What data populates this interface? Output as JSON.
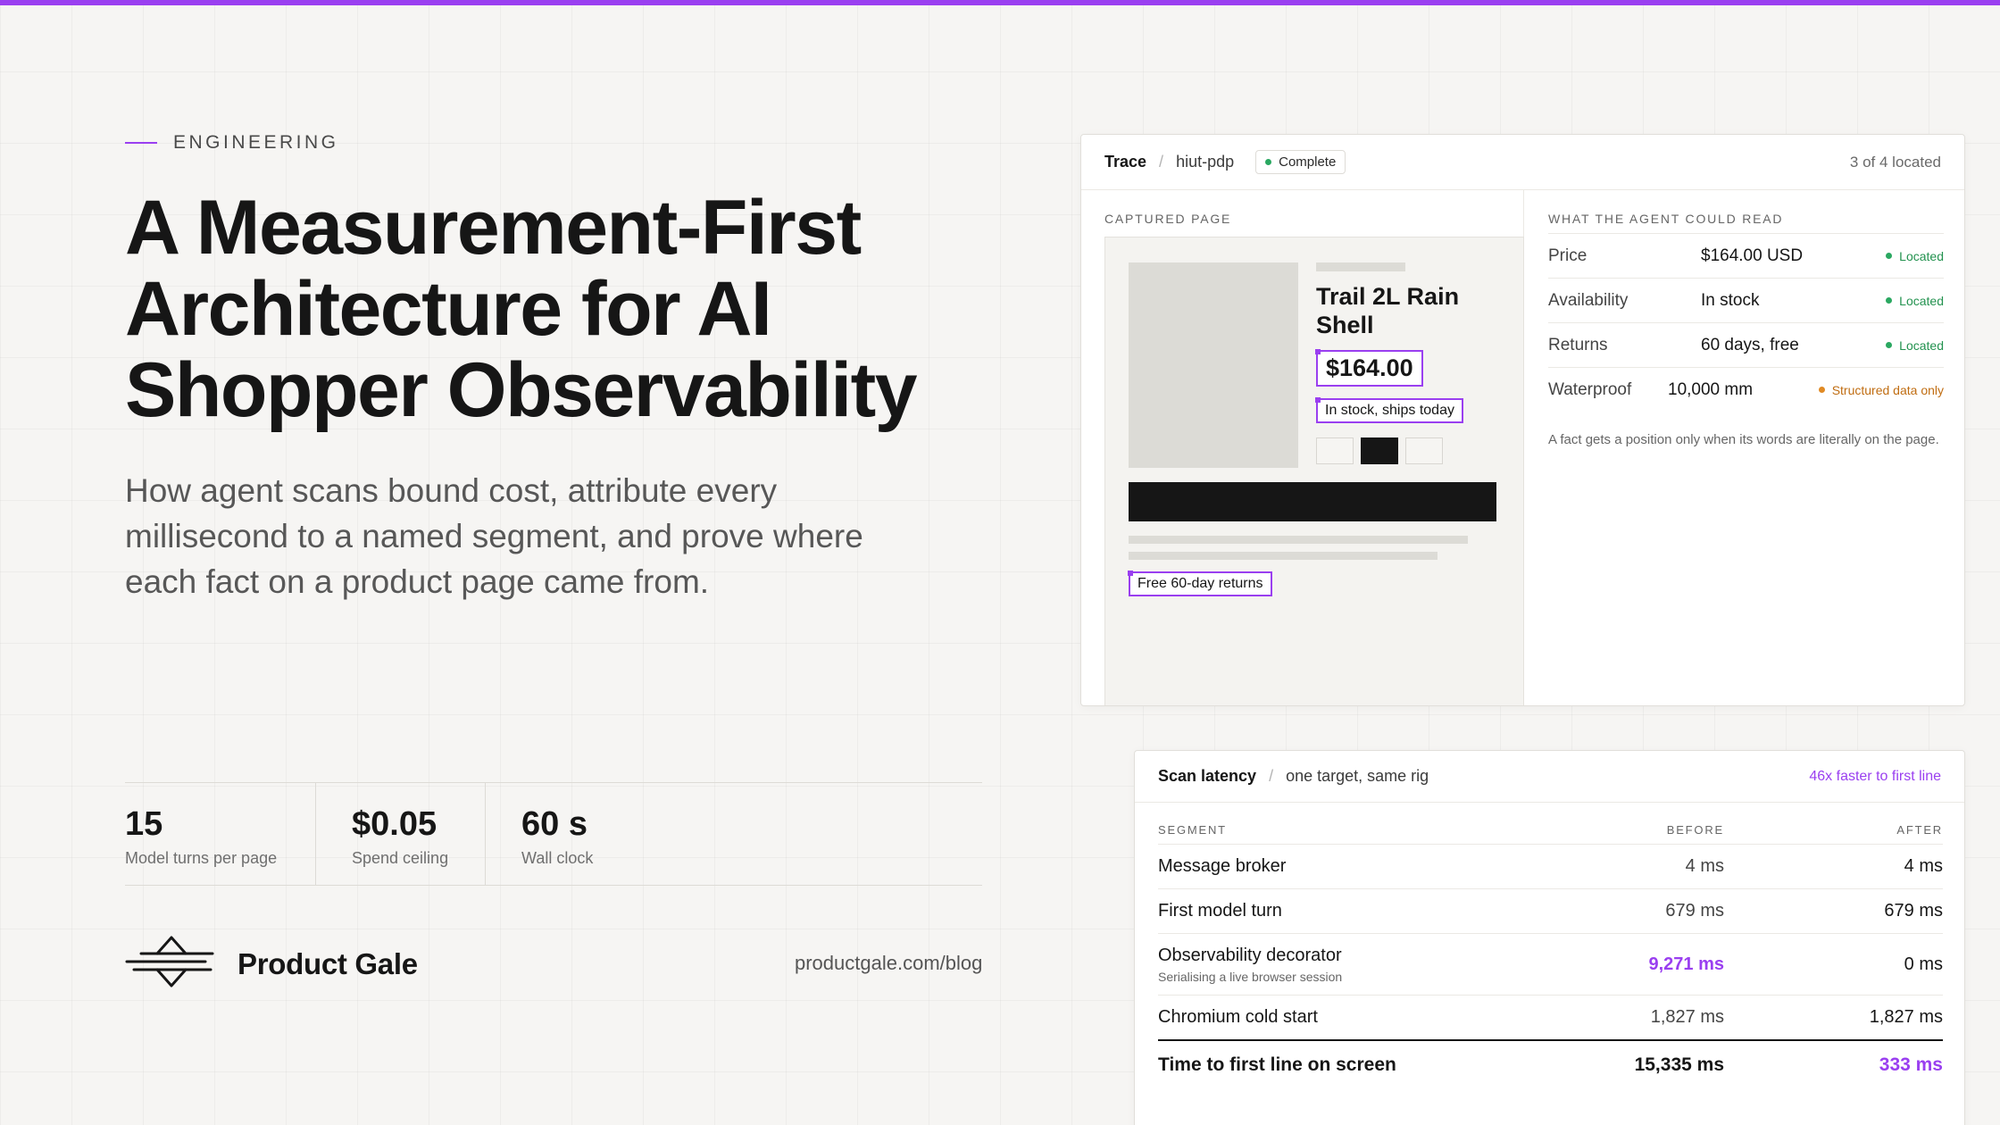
{
  "colors": {
    "accent": "#9a3ff0",
    "located": "#23924f",
    "structured": "#c06d12"
  },
  "eyebrow": "ENGINEERING",
  "headline": "A Measurement-First Architecture for AI Shopper Observability",
  "subtitle": "How agent scans bound cost, attribute every millisecond to a named segment, and prove where each fact on a product page came from.",
  "stats": [
    {
      "value": "15",
      "label": "Model turns per page"
    },
    {
      "value": "$0.05",
      "label": "Spend ceiling"
    },
    {
      "value": "60 s",
      "label": "Wall clock"
    }
  ],
  "brand": {
    "name": "Product Gale",
    "icon": "product-gale-logo",
    "url": "productgale.com/blog"
  },
  "trace": {
    "title": "Trace",
    "target": "hiut-pdp",
    "status": "Complete",
    "located_summary": "3 of 4 located",
    "captured_label": "CAPTURED PAGE",
    "product": {
      "title": "Trail 2L Rain Shell",
      "price": "$164.00",
      "stock": "In stock, ships today",
      "returns": "Free 60-day returns"
    },
    "read_label": "WHAT THE AGENT COULD READ",
    "facts": [
      {
        "key": "Price",
        "value": "$164.00 USD",
        "status": "Located"
      },
      {
        "key": "Availability",
        "value": "In stock",
        "status": "Located"
      },
      {
        "key": "Returns",
        "value": "60 days, free",
        "status": "Located"
      },
      {
        "key": "Waterproof",
        "value": "10,000 mm",
        "status": "Structured data only"
      }
    ],
    "note": "A fact gets a position only when its words are literally on the page."
  },
  "latency": {
    "title": "Scan latency",
    "context": "one target, same rig",
    "headline_stat": "46x faster to first line",
    "columns": [
      "SEGMENT",
      "BEFORE",
      "AFTER"
    ],
    "rows": [
      {
        "segment": "Message broker",
        "before": "4 ms",
        "after": "4 ms"
      },
      {
        "segment": "First model turn",
        "before": "679 ms",
        "after": "679 ms"
      },
      {
        "segment": "Observability decorator",
        "note": "Serialising a live browser session",
        "before": "9,271 ms",
        "after": "0 ms"
      },
      {
        "segment": "Chromium cold start",
        "before": "1,827 ms",
        "after": "1,827 ms"
      }
    ],
    "total": {
      "segment": "Time to first line on screen",
      "before": "15,335 ms",
      "after": "333 ms"
    }
  }
}
